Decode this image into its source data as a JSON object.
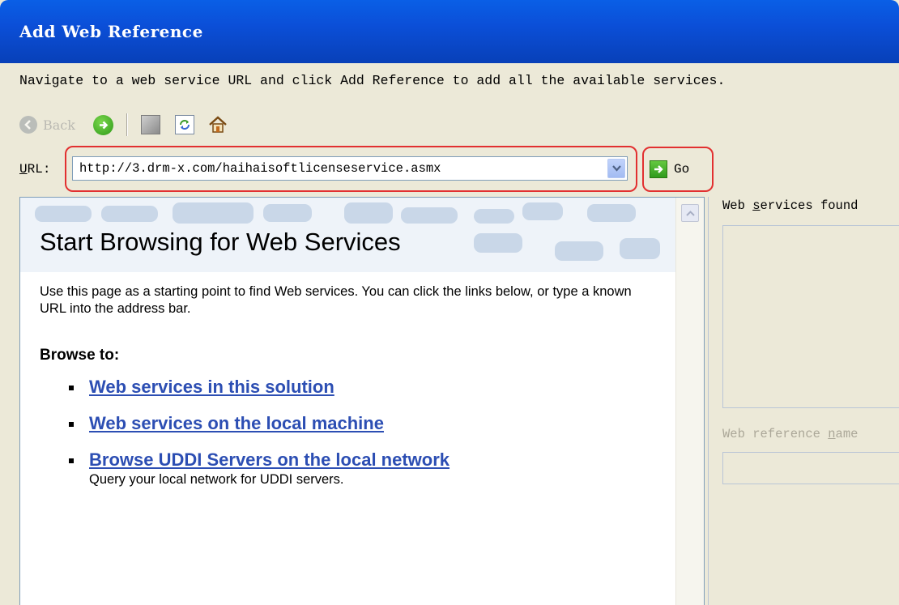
{
  "window": {
    "title": "Add Web Reference"
  },
  "instruction": "Navigate to a web service URL and click Add Reference to add all the available services.",
  "toolbar": {
    "back_label": "Back"
  },
  "url_bar": {
    "label": "URL:",
    "label_mnemonic": "U",
    "label_rest": "RL:",
    "value": "http://3.drm-x.com/haihaisoftlicenseservice.asmx",
    "go_label": "Go"
  },
  "browser": {
    "heading": "Start Browsing for Web Services",
    "intro": "Use this page as a starting point to find Web services. You can click the links below, or type a known URL into the address bar.",
    "browse_to": "Browse to:",
    "links": [
      {
        "label": "Web services in this solution",
        "desc": ""
      },
      {
        "label": "Web services on the local machine",
        "desc": ""
      },
      {
        "label": "Browse UDDI Servers on the local network",
        "desc": "Query your local network for UDDI servers."
      }
    ]
  },
  "right_panel": {
    "services_found_pre": "Web ",
    "services_found_mnemonic": "s",
    "services_found_post": "ervices found",
    "reference_name_pre": "Web reference ",
    "reference_name_mnemonic": "n",
    "reference_name_post": "ame"
  },
  "colors": {
    "titlebar": "#0a5fe6",
    "highlight": "#e23030",
    "link": "#2c4eb3",
    "dialog_bg": "#ece9d8"
  }
}
